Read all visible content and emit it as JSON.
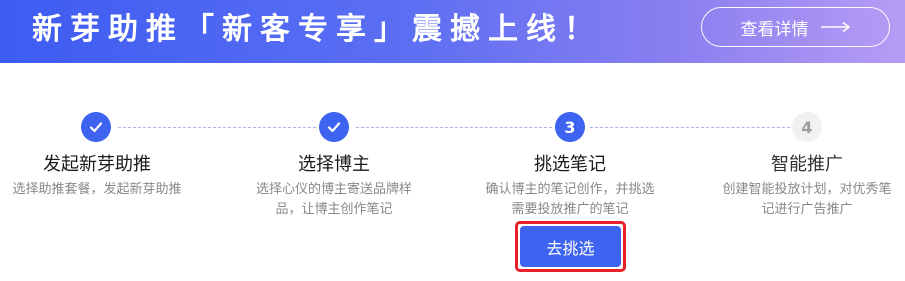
{
  "banner": {
    "title": "新芽助推「新客专享」震撼上线！",
    "details_label": "查看详情",
    "gradient_start": "#3d5cf2",
    "gradient_end": "#b79cf5"
  },
  "steps": [
    {
      "status": "completed",
      "marker": "check-icon",
      "title": "发起新芽助推",
      "desc_lines": [
        "选择助推套餐，发起新芽助推"
      ]
    },
    {
      "status": "completed",
      "marker": "check-icon",
      "title": "选择博主",
      "desc_lines": [
        "选择心仪的博主寄送品牌样",
        "品，让博主创作笔记"
      ]
    },
    {
      "status": "current",
      "number": "3",
      "title": "挑选笔记",
      "desc_lines": [
        "确认博主的笔记创作，并挑选",
        "需要投放推广的笔记"
      ]
    },
    {
      "status": "pending",
      "number": "4",
      "title": "智能推广",
      "desc_lines": [
        "创建智能投放计划，对优秀笔",
        "记进行广告推广"
      ]
    }
  ],
  "action": {
    "pick_label": "去挑选",
    "highlight_color": "#e8202a"
  },
  "colors": {
    "accent": "#3d63f0",
    "pending_circle": "#f1f1f1"
  }
}
